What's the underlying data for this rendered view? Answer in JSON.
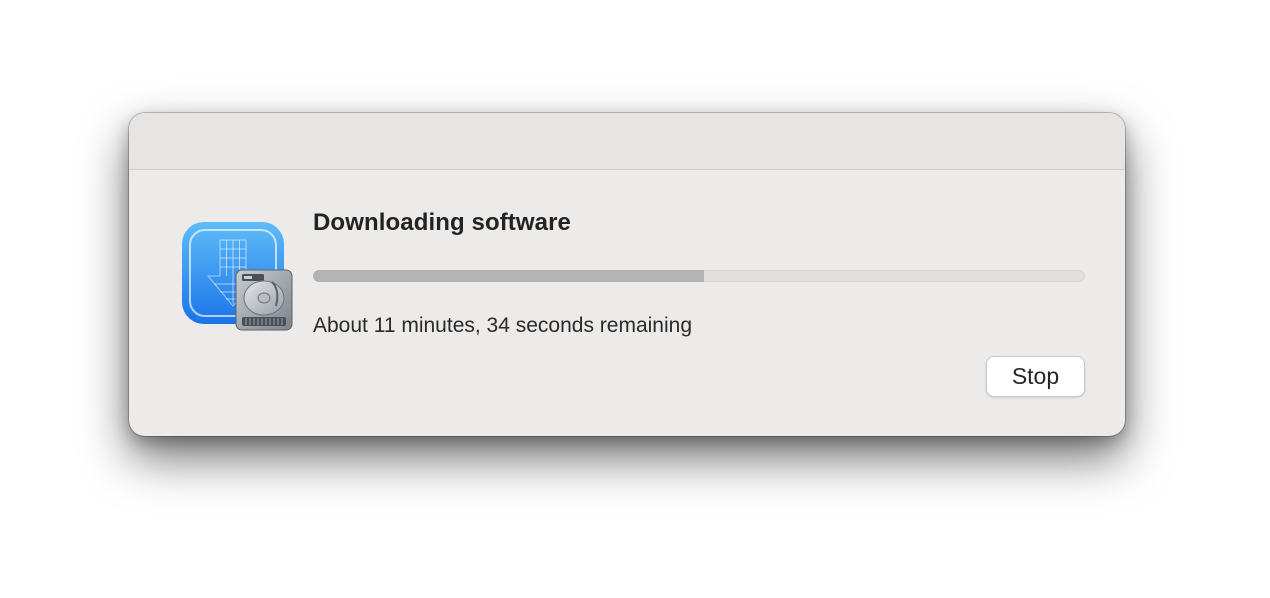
{
  "dialog": {
    "title": "Downloading software",
    "status_text": "About 11 minutes, 34 seconds remaining",
    "progress_fraction": 0.506,
    "stop_label": "Stop",
    "icon": "software-update-download-icon"
  },
  "colors": {
    "icon_blue_top": "#5fbcf8",
    "icon_blue_bottom": "#1a74e8",
    "progress_fill": "#b4b4b4",
    "progress_track": "#e1e0df",
    "window_bg": "#ecebea"
  }
}
